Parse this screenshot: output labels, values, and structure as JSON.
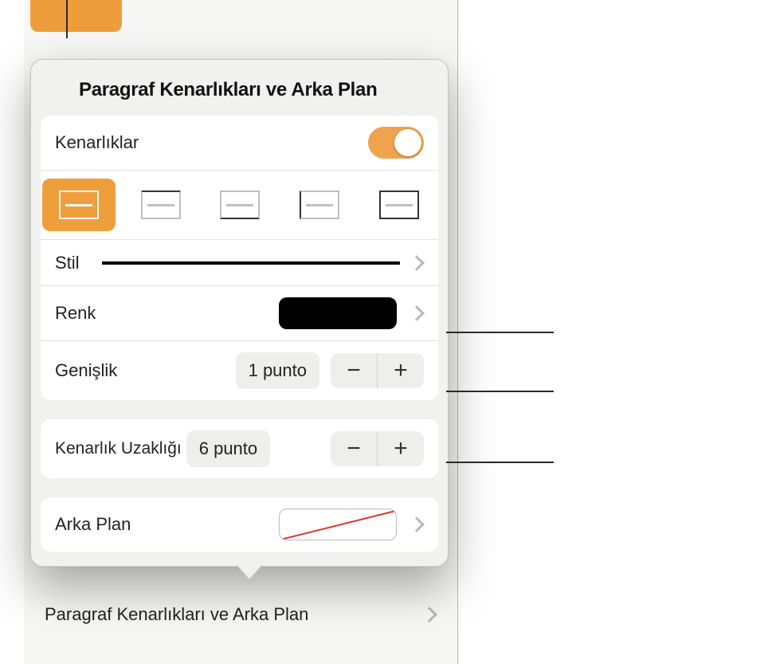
{
  "panel": {
    "title": "Paragraf Kenarlıkları ve Arka Plan"
  },
  "borders": {
    "label": "Kenarlıklar",
    "enabled": true
  },
  "style": {
    "label": "Stil"
  },
  "color": {
    "label": "Renk",
    "value_hex": "#000000"
  },
  "width": {
    "label": "Genişlik",
    "value": "1 punto"
  },
  "offset": {
    "label": "Kenarlık Uzaklığı",
    "value": "6 punto"
  },
  "background": {
    "label": "Arka Plan"
  },
  "under_row": {
    "label": "Paragraf Kenarlıkları ve Arka Plan"
  }
}
